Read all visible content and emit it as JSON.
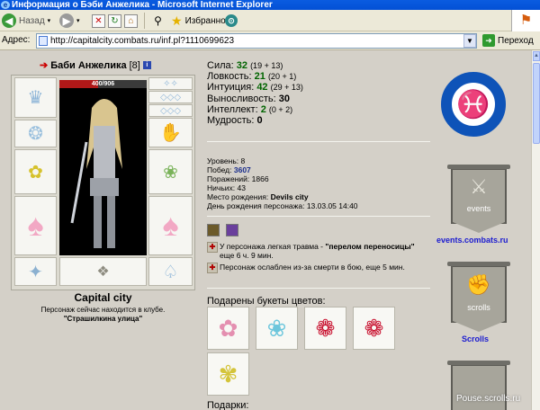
{
  "window": {
    "title": "Информация о Бэби Анжелика - Microsoft Internet Explorer"
  },
  "toolbar": {
    "back_label": "Назад",
    "favorites_label": "Избранное"
  },
  "address_bar": {
    "label": "Адрес:",
    "url": "http://capitalcity.combats.ru/inf.pl?1110699623",
    "go_label": "Переход"
  },
  "character": {
    "name": "Баби Анжелика",
    "level_badge": "[8]",
    "hp": "400/906",
    "hp_fraction": 0.44,
    "city": "Capital city",
    "location_prefix": "Персонаж сейчас находится в клубе.",
    "location": "\"Страшилкина улица\""
  },
  "stats": [
    {
      "label": "Сила:",
      "value": "32",
      "bonus": "(19 + 13)"
    },
    {
      "label": "Ловкость:",
      "value": "21",
      "bonus": "(20 + 1)"
    },
    {
      "label": "Интуиция:",
      "value": "42",
      "bonus": "(29 + 13)"
    },
    {
      "label": "Выносливость:",
      "value": "30",
      "bonus": ""
    },
    {
      "label": "Интеллект:",
      "value": "2",
      "bonus": "(0 + 2)"
    },
    {
      "label": "Мудрость:",
      "value": "0",
      "bonus": ""
    }
  ],
  "extra": [
    {
      "label": "Уровень:",
      "value": "8"
    },
    {
      "label": "Побед:",
      "value": "3607"
    },
    {
      "label": "Поражений:",
      "value": "1866"
    },
    {
      "label": "Ничьих:",
      "value": "43"
    },
    {
      "label": "Место рождения:",
      "value": "Devils city"
    },
    {
      "label": "День рождения персонажа:",
      "value": "13.03.05 14:40"
    }
  ],
  "effects": [
    {
      "before": "У персонажа легкая травма - ",
      "bold": "\"перелом переносицы\"",
      "after": " еще 6 ч. 9 мин."
    },
    {
      "before": "Персонаж ослаблен из-за смерти в бою, еще 5 мин.",
      "bold": "",
      "after": ""
    }
  ],
  "bouquets_title": "Подарены букеты цветов:",
  "gifts_title": "Подарки:",
  "sidebar": {
    "events_label": "events",
    "events_link": "events.combats.ru",
    "scrolls_label": "scrolls",
    "scrolls_link": "Scrolls"
  },
  "watermark": "Pouse.scrolls.ru",
  "icons": {
    "emblem": "twin-fish-emblem-icon",
    "flowers": [
      "pink-blossom-icon",
      "blue-flowers-icon",
      "red-roses-icon",
      "red-roses-icon",
      "daisy-bouquet-icon"
    ]
  }
}
